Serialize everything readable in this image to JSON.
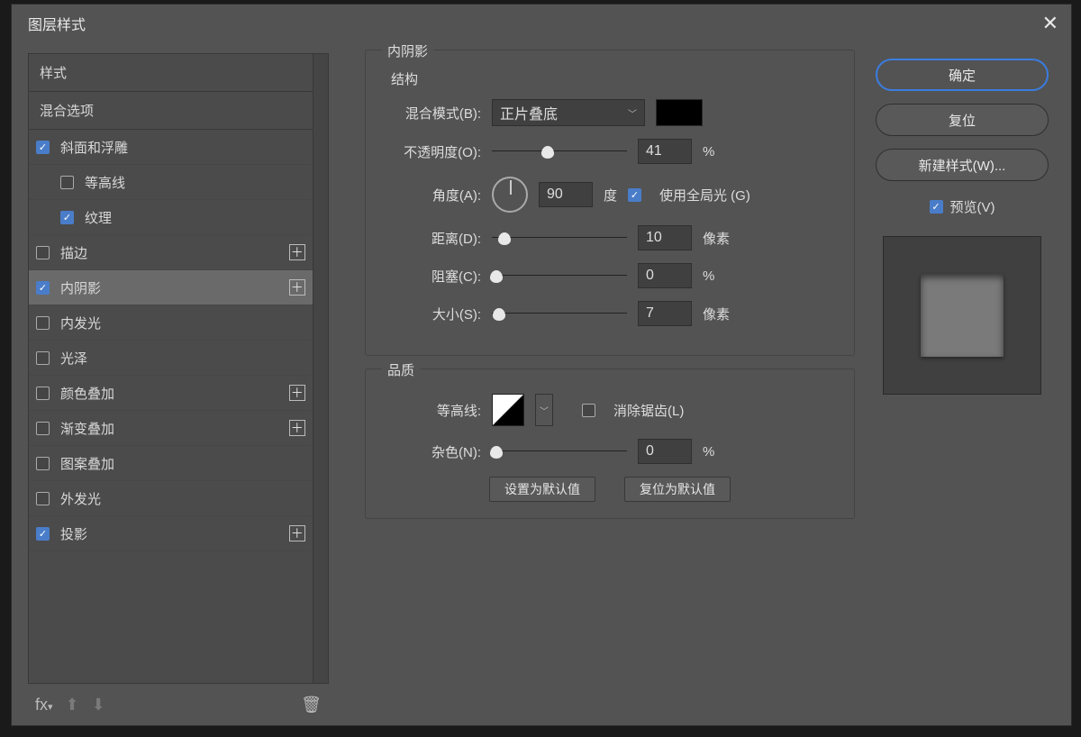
{
  "title": "图层样式",
  "sidebar": {
    "header1": "样式",
    "header2": "混合选项",
    "items": [
      {
        "label": "斜面和浮雕",
        "checked": true,
        "indent": false,
        "plus": false
      },
      {
        "label": "等高线",
        "checked": false,
        "indent": true,
        "plus": false
      },
      {
        "label": "纹理",
        "checked": true,
        "indent": true,
        "plus": false
      },
      {
        "label": "描边",
        "checked": false,
        "indent": false,
        "plus": true
      },
      {
        "label": "内阴影",
        "checked": true,
        "indent": false,
        "plus": true,
        "selected": true
      },
      {
        "label": "内发光",
        "checked": false,
        "indent": false,
        "plus": false
      },
      {
        "label": "光泽",
        "checked": false,
        "indent": false,
        "plus": false
      },
      {
        "label": "颜色叠加",
        "checked": false,
        "indent": false,
        "plus": true
      },
      {
        "label": "渐变叠加",
        "checked": false,
        "indent": false,
        "plus": true
      },
      {
        "label": "图案叠加",
        "checked": false,
        "indent": false,
        "plus": false
      },
      {
        "label": "外发光",
        "checked": false,
        "indent": false,
        "plus": false
      },
      {
        "label": "投影",
        "checked": true,
        "indent": false,
        "plus": true
      }
    ],
    "footer_fx": "fx"
  },
  "panel_title": "内阴影",
  "structure": {
    "legend": "结构",
    "blend_mode_label": "混合模式(B):",
    "blend_mode_value": "正片叠底",
    "opacity_label": "不透明度(O):",
    "opacity_value": "41",
    "opacity_unit": "%",
    "angle_label": "角度(A):",
    "angle_value": "90",
    "angle_unit": "度",
    "global_light_label": "使用全局光 (G)",
    "global_light_checked": true,
    "distance_label": "距离(D):",
    "distance_value": "10",
    "distance_unit": "像素",
    "choke_label": "阻塞(C):",
    "choke_value": "0",
    "choke_unit": "%",
    "size_label": "大小(S):",
    "size_value": "7",
    "size_unit": "像素"
  },
  "quality": {
    "legend": "品质",
    "contour_label": "等高线:",
    "antialias_label": "消除锯齿(L)",
    "antialias_checked": false,
    "noise_label": "杂色(N):",
    "noise_value": "0",
    "noise_unit": "%"
  },
  "defaults": {
    "set": "设置为默认值",
    "reset": "复位为默认值"
  },
  "buttons": {
    "ok": "确定",
    "cancel": "复位",
    "new_style": "新建样式(W)...",
    "preview_label": "预览(V)",
    "preview_checked": true
  }
}
